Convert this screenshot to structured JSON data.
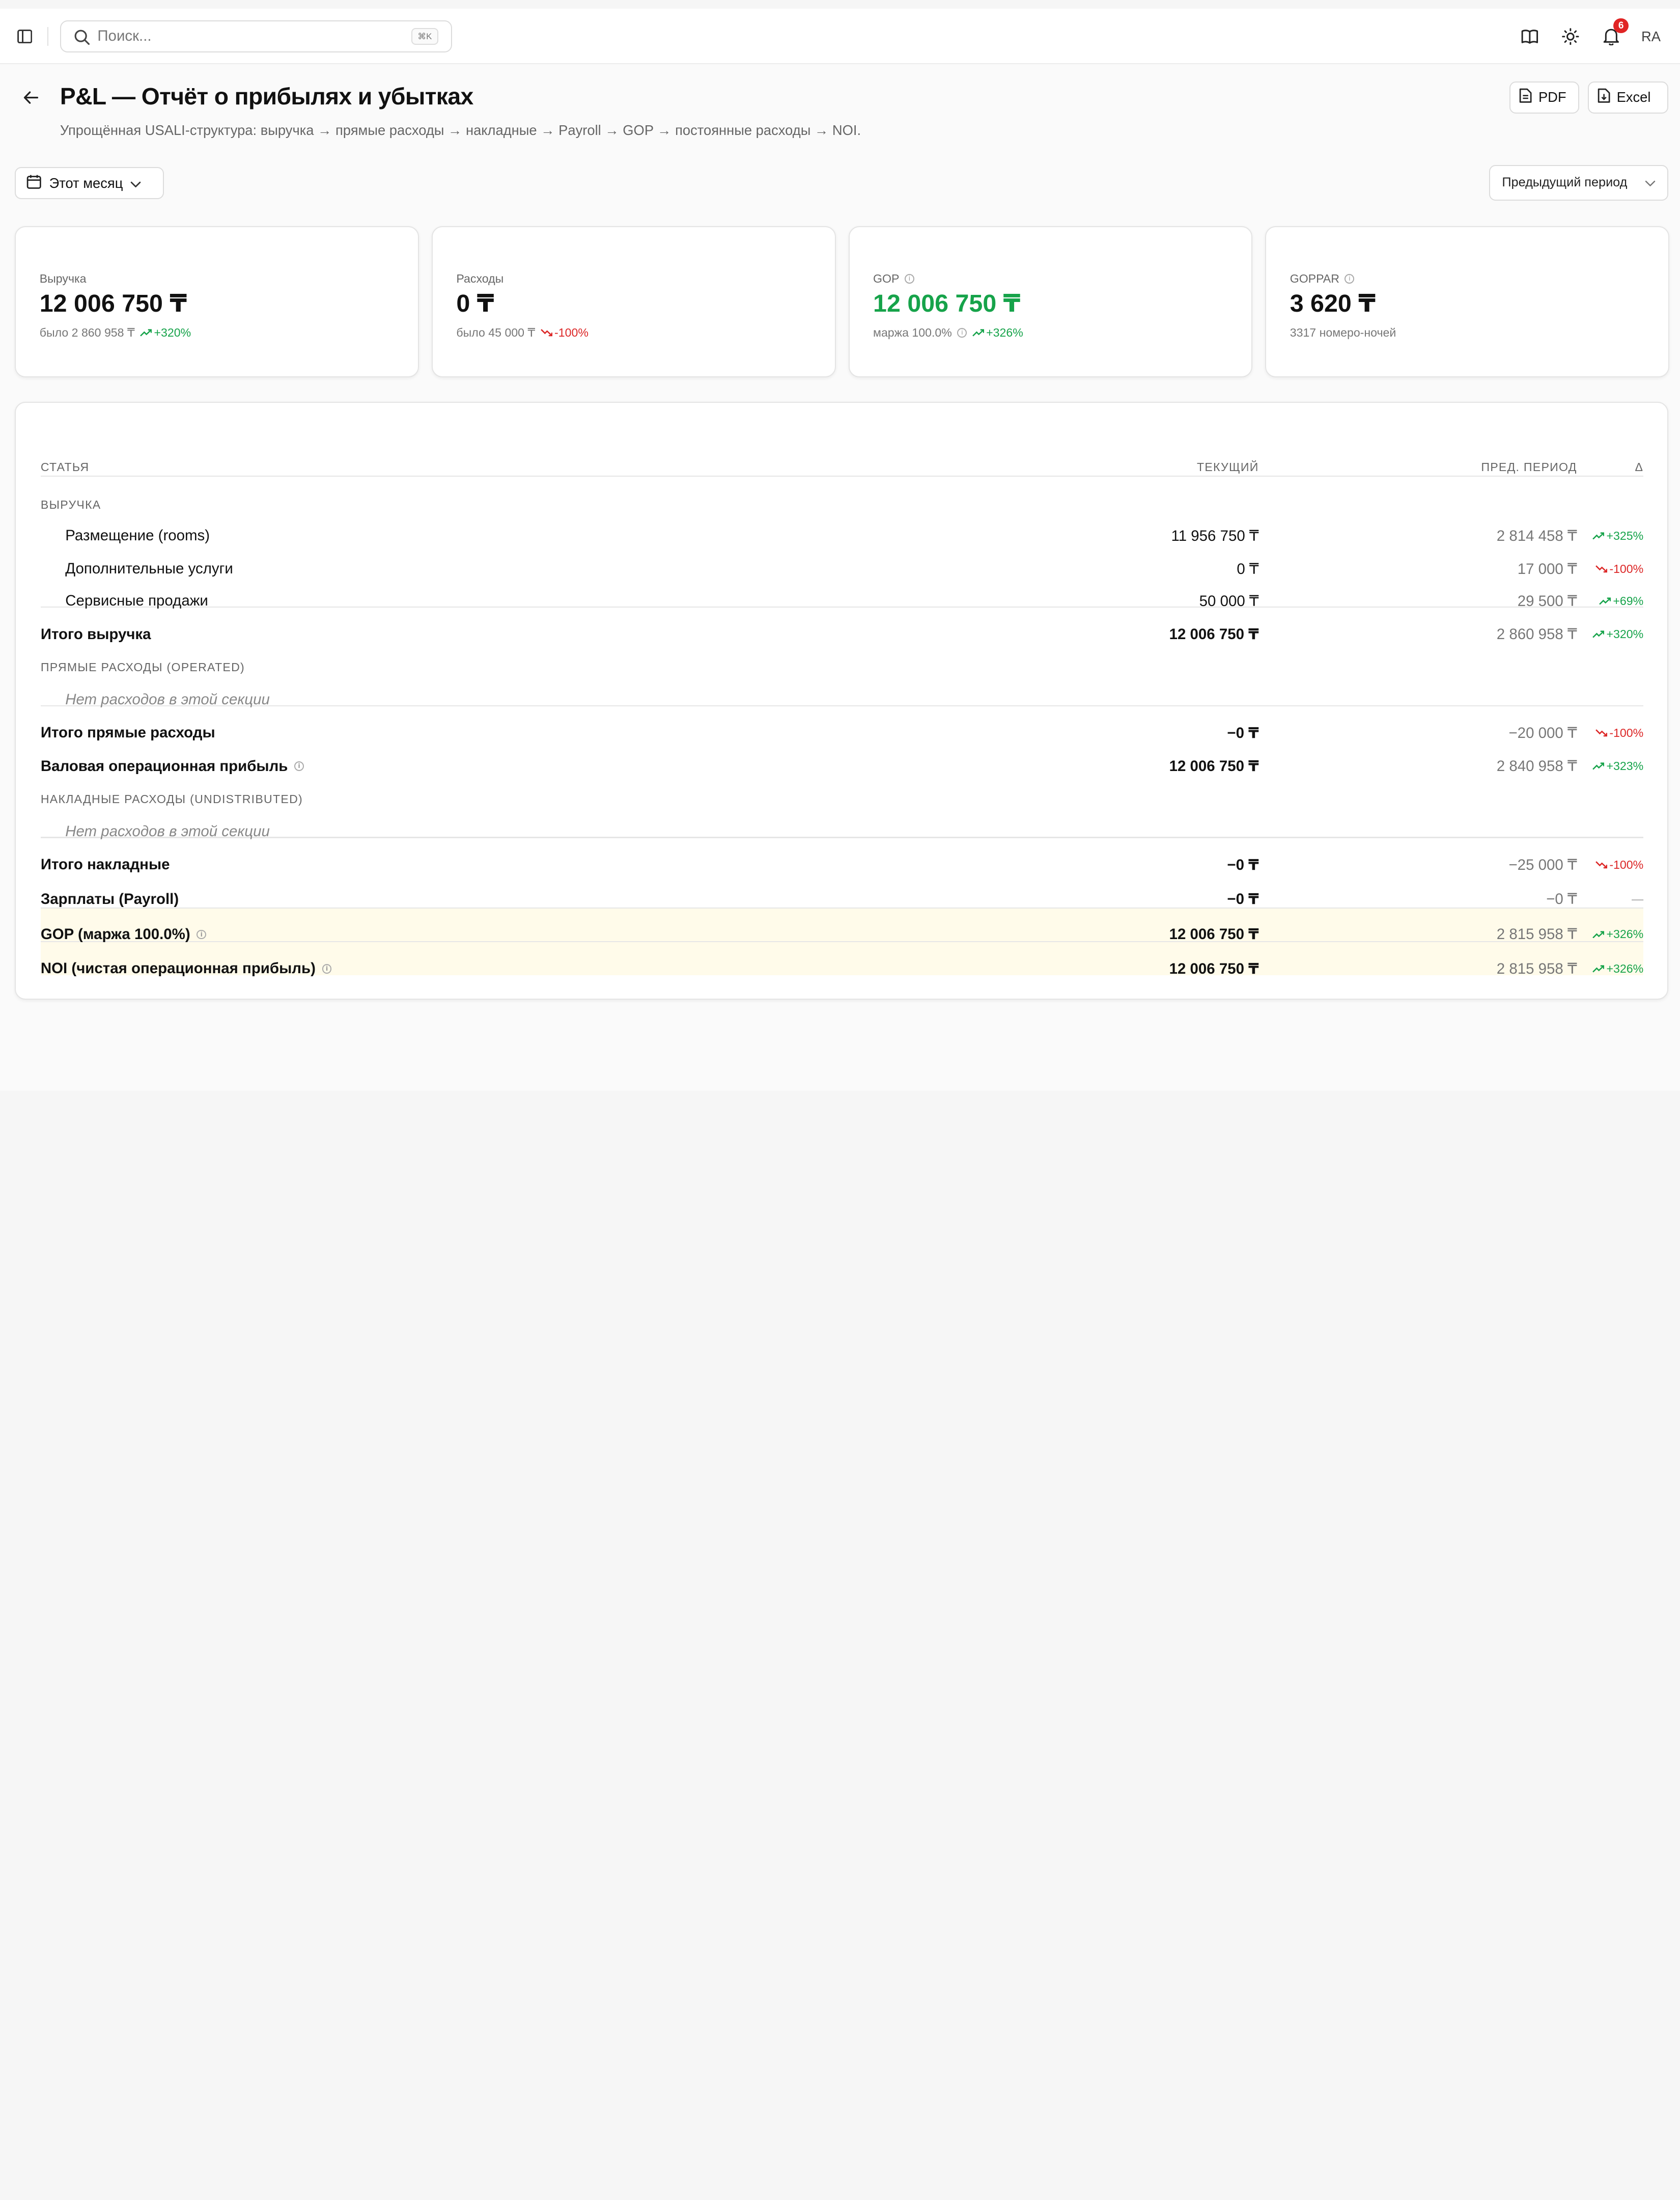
{
  "topbar": {
    "search_placeholder": "Поиск...",
    "search_shortcut": "⌘K",
    "notifications_count": "6",
    "avatar_initials": "RA"
  },
  "header": {
    "title": "P&L — Отчёт о прибылях и убытках",
    "subtitle": "Упрощённая USALI-структура: выручка → прямые расходы → накладные → Payroll → GOP → постоянные расходы → NOI.",
    "pdf_label": "PDF",
    "excel_label": "Excel"
  },
  "filters": {
    "period": "Этот месяц",
    "compare": "Предыдущий период"
  },
  "kpis": [
    {
      "label": "Выручка",
      "value": "12 006 750 ₸",
      "sub": "было 2 860 958 ₸",
      "delta": "+320%",
      "trend": "up",
      "info": false
    },
    {
      "label": "Расходы",
      "value": "0 ₸",
      "sub": "было 45 000 ₸",
      "delta": "-100%",
      "trend": "down",
      "info": false
    },
    {
      "label": "GOP",
      "value": "12 006 750 ₸",
      "sub": "маржа 100.0%",
      "delta": "+326%",
      "trend": "up",
      "info": true
    },
    {
      "label": "GOPPAR",
      "value": "3 620 ₸",
      "sub": "3317 номеро-ночей",
      "delta": "",
      "trend": "",
      "info": true
    }
  ],
  "table": {
    "headers": {
      "name": "СТАТЬЯ",
      "current": "ТЕКУЩИЙ",
      "previous": "ПРЕД. ПЕРИОД",
      "delta": "Δ"
    },
    "rows": [
      {
        "type": "section",
        "name": "ВЫРУЧКА"
      },
      {
        "type": "item",
        "name": "Размещение (rooms)",
        "current": "11 956 750 ₸",
        "previous": "2 814 458 ₸",
        "delta": "+325%",
        "trend": "up"
      },
      {
        "type": "item",
        "name": "Дополнительные услуги",
        "current": "0 ₸",
        "previous": "17 000 ₸",
        "delta": "-100%",
        "trend": "down"
      },
      {
        "type": "item",
        "name": "Сервисные продажи",
        "current": "50 000 ₸",
        "previous": "29 500 ₸",
        "delta": "+69%",
        "trend": "up"
      },
      {
        "type": "total",
        "name": "Итого выручка",
        "current": "12 006 750 ₸",
        "previous": "2 860 958 ₸",
        "delta": "+320%",
        "trend": "up"
      },
      {
        "type": "section",
        "name": "ПРЯМЫЕ РАСХОДЫ (OPERATED)"
      },
      {
        "type": "empty",
        "name": "Нет расходов в этой секции"
      },
      {
        "type": "total",
        "name": "Итого прямые расходы",
        "current": "−0 ₸",
        "previous": "−20 000 ₸",
        "delta": "-100%",
        "trend": "down"
      },
      {
        "type": "total",
        "name": "Валовая операционная прибыль",
        "current": "12 006 750 ₸",
        "previous": "2 840 958 ₸",
        "delta": "+323%",
        "trend": "up",
        "info": true
      },
      {
        "type": "section",
        "name": "НАКЛАДНЫЕ РАСХОДЫ (UNDISTRIBUTED)"
      },
      {
        "type": "empty",
        "name": "Нет расходов в этой секции"
      },
      {
        "type": "total",
        "name": "Итого накладные",
        "current": "−0 ₸",
        "previous": "−25 000 ₸",
        "delta": "-100%",
        "trend": "down"
      },
      {
        "type": "total",
        "name": "Зарплаты (Payroll)",
        "current": "−0 ₸",
        "previous": "−0 ₸",
        "delta": "—",
        "trend": "none"
      },
      {
        "type": "highlight",
        "name": "GOP (маржа 100.0%)",
        "current": "12 006 750 ₸",
        "previous": "2 815 958 ₸",
        "delta": "+326%",
        "trend": "up",
        "info": true
      },
      {
        "type": "highlight",
        "name": "NOI (чистая операционная прибыль)",
        "current": "12 006 750 ₸",
        "previous": "2 815 958 ₸",
        "delta": "+326%",
        "trend": "up",
        "info": true
      }
    ]
  },
  "colors": {
    "positive": "#16a34a",
    "negative": "#dc2626",
    "highlight_bg": "#fffbea",
    "badge": "#e02424"
  }
}
